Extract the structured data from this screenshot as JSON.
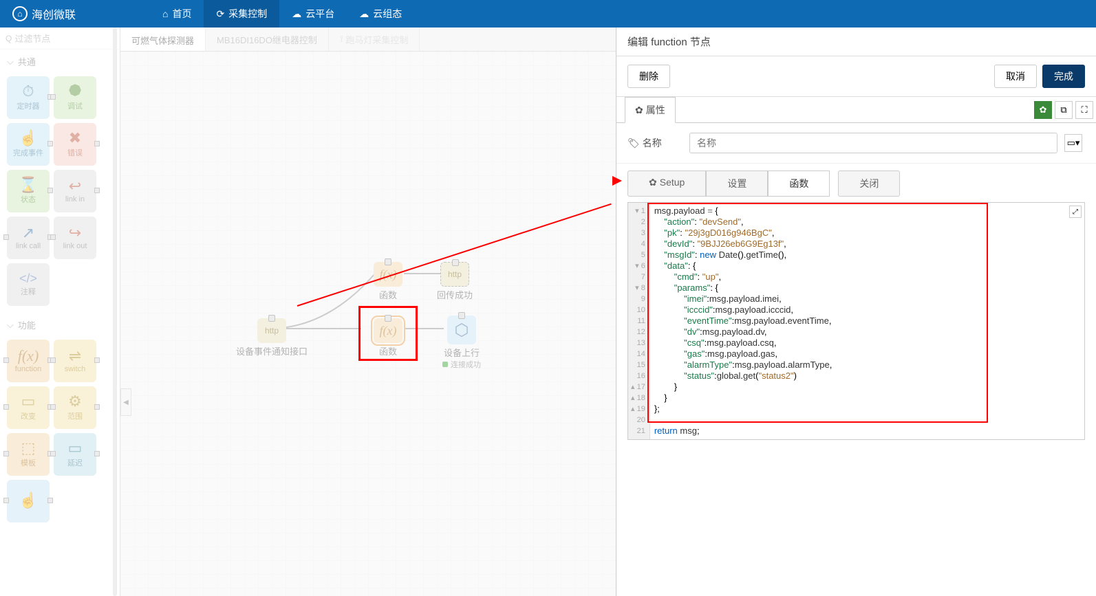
{
  "brand": "海创微联",
  "topnav": {
    "items": [
      {
        "icon": "⌂",
        "label": "首页"
      },
      {
        "icon": "⟳",
        "label": "采集控制",
        "active": true
      },
      {
        "icon": "☁",
        "label": "云平台"
      },
      {
        "icon": "☁",
        "label": "云组态"
      }
    ]
  },
  "palette": {
    "filter": {
      "placeholder": "过滤节点",
      "icon": "Q"
    },
    "sections": [
      {
        "title": "共通",
        "nodes": [
          {
            "label": "定时器",
            "icon": "⏱",
            "cls": "c-blue"
          },
          {
            "label": "调试",
            "icon": "🐞",
            "cls": "c-green"
          },
          {
            "label": "完成事件",
            "icon": "☝",
            "cls": "c-blue"
          },
          {
            "label": "错误",
            "icon": "✖",
            "cls": "c-red"
          },
          {
            "label": "状态",
            "icon": "⌛",
            "cls": "c-green"
          },
          {
            "label": "link in",
            "icon": "↩",
            "cls": "c-gray"
          },
          {
            "label": "link call",
            "icon": "↗",
            "cls": "c-gray"
          },
          {
            "label": "link out",
            "icon": "↪",
            "cls": "c-gray"
          },
          {
            "label": "注释",
            "icon": "</>",
            "cls": "c-gray"
          }
        ]
      },
      {
        "title": "功能",
        "nodes": [
          {
            "label": "function",
            "icon": "f(x)",
            "cls": "c-orange"
          },
          {
            "label": "switch",
            "icon": "⇌",
            "cls": "c-yellow"
          },
          {
            "label": "改变",
            "icon": "📘",
            "cls": "c-yellow"
          },
          {
            "label": "范围",
            "icon": "⚙",
            "cls": "c-yellow"
          },
          {
            "label": "模板",
            "icon": "⬚",
            "cls": "c-orange"
          },
          {
            "label": "延迟",
            "icon": "⏸",
            "cls": "c-cyan"
          },
          {
            "label": "",
            "icon": "☝",
            "cls": "c-lblue"
          }
        ]
      }
    ]
  },
  "tabs": [
    {
      "label": "可燃气体探测器",
      "active": true
    },
    {
      "label": "MB16DI16DO继电器控制"
    },
    {
      "label": "跑马灯采集控制",
      "faded": true
    }
  ],
  "flow": {
    "nodes": {
      "http_in": {
        "label": "设备事件通知接口"
      },
      "fx1": {
        "label": "函数"
      },
      "http_out": {
        "label": "回传成功"
      },
      "fx2": {
        "label": "函数"
      },
      "dev_up": {
        "label": "设备上行",
        "status": "连接成功"
      }
    }
  },
  "editor": {
    "title": "编辑 function 节点",
    "delete": "删除",
    "cancel": "取消",
    "done": "完成",
    "props_tab": "属性",
    "name_label": "名称",
    "name_placeholder": "名称",
    "subtabs": {
      "setup": "Setup",
      "settings": "设置",
      "func": "函数",
      "close": "关闭"
    },
    "code": {
      "lines": 21,
      "action": "devSend",
      "pk": "29j3gD016g946BgC",
      "devId": "9BJJ26eb6G9Eg13f",
      "cmd": "up",
      "status": "status2"
    }
  }
}
